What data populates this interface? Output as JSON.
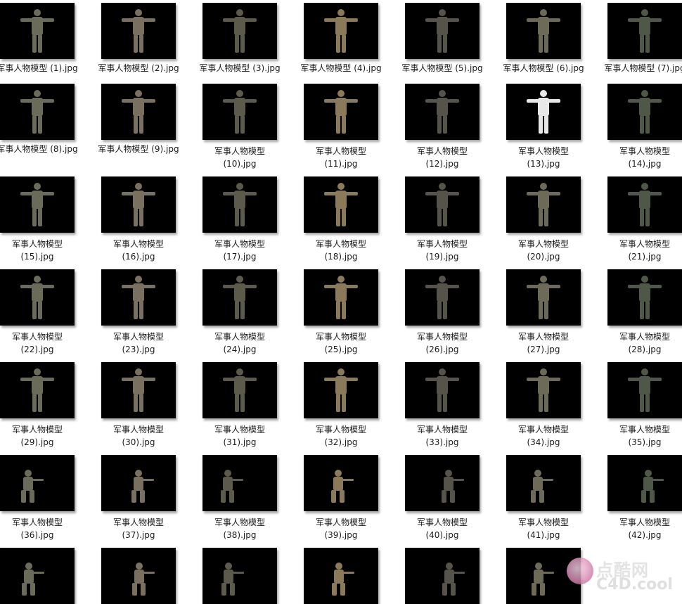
{
  "folder": {
    "items": [
      {
        "name": "军事人物模型 (1).jpg"
      },
      {
        "name": "军事人物模型 (2).jpg"
      },
      {
        "name": "军事人物模型 (3).jpg"
      },
      {
        "name": "军事人物模型 (4).jpg"
      },
      {
        "name": "军事人物模型 (5).jpg"
      },
      {
        "name": "军事人物模型 (6).jpg"
      },
      {
        "name": "军事人物模型 (7).jpg"
      },
      {
        "name": "军事人物模型 (8).jpg"
      },
      {
        "name": "军事人物模型 (9).jpg"
      },
      {
        "name": "军事人物模型\n(10).jpg"
      },
      {
        "name": "军事人物模型\n(11).jpg"
      },
      {
        "name": "军事人物模型\n(12).jpg"
      },
      {
        "name": "军事人物模型\n(13).jpg"
      },
      {
        "name": "军事人物模型\n(14).jpg"
      },
      {
        "name": "军事人物模型\n(15).jpg"
      },
      {
        "name": "军事人物模型\n(16).jpg"
      },
      {
        "name": "军事人物模型\n(17).jpg"
      },
      {
        "name": "军事人物模型\n(18).jpg"
      },
      {
        "name": "军事人物模型\n(19).jpg"
      },
      {
        "name": "军事人物模型\n(20).jpg"
      },
      {
        "name": "军事人物模型\n(21).jpg"
      },
      {
        "name": "军事人物模型\n(22).jpg"
      },
      {
        "name": "军事人物模型\n(23).jpg"
      },
      {
        "name": "军事人物模型\n(24).jpg"
      },
      {
        "name": "军事人物模型\n(25).jpg"
      },
      {
        "name": "军事人物模型\n(26).jpg"
      },
      {
        "name": "军事人物模型\n(27).jpg"
      },
      {
        "name": "军事人物模型\n(28).jpg"
      },
      {
        "name": "军事人物模型\n(29).jpg"
      },
      {
        "name": "军事人物模型\n(30).jpg"
      },
      {
        "name": "军事人物模型\n(31).jpg"
      },
      {
        "name": "军事人物模型\n(32).jpg"
      },
      {
        "name": "军事人物模型\n(33).jpg"
      },
      {
        "name": "军事人物模型\n(34).jpg"
      },
      {
        "name": "军事人物模型\n(35).jpg"
      },
      {
        "name": "军事人物模型\n(36).jpg"
      },
      {
        "name": "军事人物模型\n(37).jpg"
      },
      {
        "name": "军事人物模型\n(38).jpg"
      },
      {
        "name": "军事人物模型\n(39).jpg"
      },
      {
        "name": "军事人物模型\n(40).jpg"
      },
      {
        "name": "军事人物模型\n(41).jpg"
      },
      {
        "name": "军事人物模型\n(42).jpg"
      },
      {
        "name": ""
      },
      {
        "name": ""
      },
      {
        "name": ""
      },
      {
        "name": ""
      },
      {
        "name": ""
      },
      {
        "name": ""
      }
    ]
  },
  "colors": {
    "thumb_bg": "#000000",
    "page_bg": "#ffffff",
    "caption_text": "#1a1a1a",
    "figure_tones": [
      "#6b6b5a",
      "#7a7060",
      "#5c5a4a",
      "#8a7a5a",
      "#55534a",
      "#6e6a58",
      "#4f5848"
    ]
  },
  "watermark": {
    "line1": "点酷网",
    "line2": "C4D.cool"
  }
}
